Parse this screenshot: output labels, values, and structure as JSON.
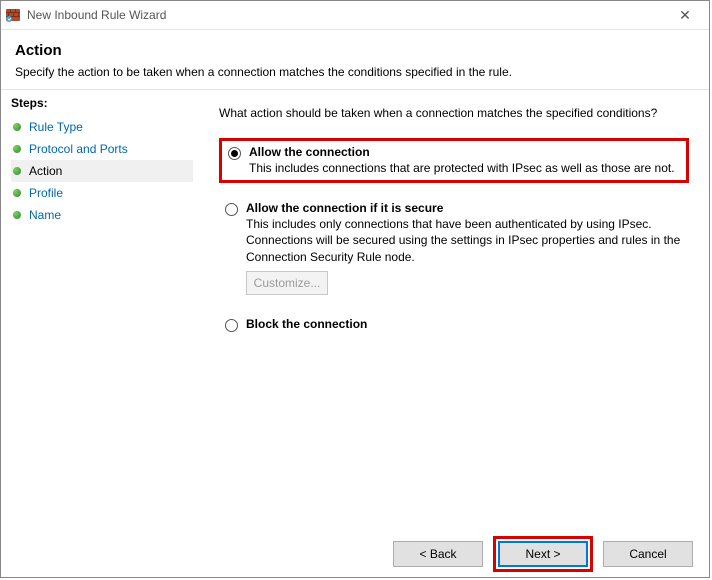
{
  "window": {
    "title": "New Inbound Rule Wizard",
    "close_glyph": "✕"
  },
  "header": {
    "heading": "Action",
    "subheading": "Specify the action to be taken when a connection matches the conditions specified in the rule."
  },
  "steps": {
    "title": "Steps:",
    "items": [
      {
        "label": "Rule Type"
      },
      {
        "label": "Protocol and Ports"
      },
      {
        "label": "Action"
      },
      {
        "label": "Profile"
      },
      {
        "label": "Name"
      }
    ]
  },
  "content": {
    "prompt": "What action should be taken when a connection matches the specified conditions?",
    "options": {
      "allow": {
        "title": "Allow the connection",
        "desc": "This includes connections that are protected with IPsec as well as those are not."
      },
      "secure": {
        "title": "Allow the connection if it is secure",
        "desc": "This includes only connections that have been authenticated by using IPsec. Connections will be secured using the settings in IPsec properties and rules in the Connection Security Rule node.",
        "customize": "Customize..."
      },
      "block": {
        "title": "Block the connection"
      }
    }
  },
  "footer": {
    "back": "< Back",
    "next": "Next >",
    "cancel": "Cancel"
  }
}
